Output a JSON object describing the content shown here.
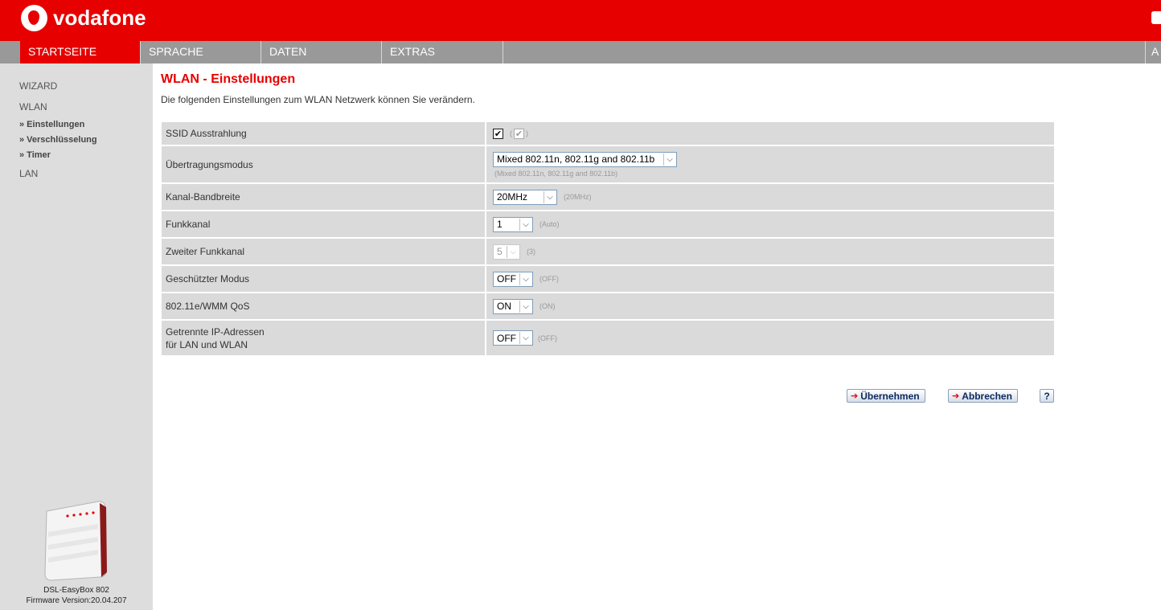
{
  "brand": {
    "name": "vodafone",
    "color": "#e60000"
  },
  "nav": {
    "items": [
      {
        "label": "STARTSEITE",
        "active": true
      },
      {
        "label": "SPRACHE",
        "active": false
      },
      {
        "label": "DATEN",
        "active": false
      },
      {
        "label": "EXTRAS",
        "active": false
      }
    ],
    "right_label": "A"
  },
  "sidebar": {
    "items": [
      {
        "label": "WIZARD"
      },
      {
        "label": "WLAN"
      }
    ],
    "subitems": [
      {
        "label": "» Einstellungen"
      },
      {
        "label": "» Verschlüsselung"
      },
      {
        "label": "» Timer"
      }
    ],
    "lan": "LAN",
    "device_name": "DSL-EasyBox 802",
    "firmware": "Firmware Version:20.04.207"
  },
  "main": {
    "title": "WLAN - Einstellungen",
    "description": "Die folgenden Einstellungen zum WLAN Netzwerk können Sie verändern.",
    "settings": {
      "ssid": {
        "label": "SSID Ausstrahlung",
        "checked": true,
        "default_open": "(",
        "default_close": ")"
      },
      "mode": {
        "label": "Übertragungsmodus",
        "value": "Mixed 802.11n, 802.11g and 802.11b",
        "default": "(Mixed 802.11n, 802.11g and 802.11b)"
      },
      "bandwidth": {
        "label": "Kanal-Bandbreite",
        "value": "20MHz",
        "default": "(20MHz)"
      },
      "channel": {
        "label": "Funkkanal",
        "value": "1",
        "default": "(Auto)"
      },
      "channel2": {
        "label": "Zweiter Funkkanal",
        "value": "5",
        "default": "(3)"
      },
      "protected": {
        "label": "Geschützter Modus",
        "value": "OFF",
        "default": "(OFF)"
      },
      "qos": {
        "label": "802.11e/WMM QoS",
        "value": "ON",
        "default": "(ON)"
      },
      "separate_ip": {
        "label_line1": "Getrennte IP-Adressen",
        "label_line2": "für LAN und WLAN",
        "value": "OFF",
        "default": "(OFF)"
      }
    },
    "buttons": {
      "apply": "Übernehmen",
      "cancel": "Abbrechen",
      "help": "?"
    }
  }
}
